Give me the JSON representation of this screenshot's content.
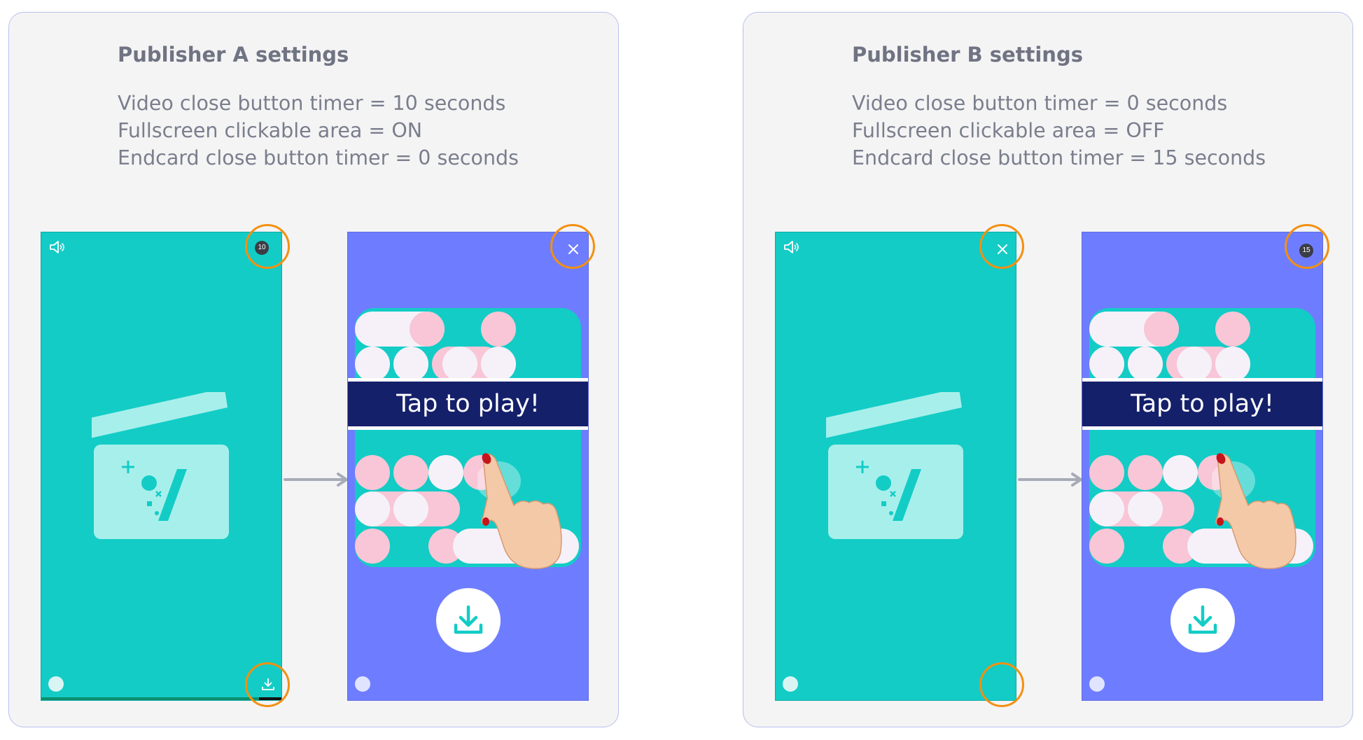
{
  "publisher_a": {
    "title": "Publisher A settings",
    "settings": [
      "Video close button timer = 10 seconds",
      "Fullscreen clickable area = ON",
      "Endcard close button timer = 0 seconds"
    ],
    "video_timer_badge": "10",
    "endcard_cta": "Tap to play!"
  },
  "publisher_b": {
    "title": "Publisher B settings",
    "settings": [
      "Video close button timer = 0 seconds",
      "Fullscreen clickable area = OFF",
      "Endcard close button timer = 15 seconds"
    ],
    "endcard_timer_badge": "15",
    "endcard_cta": "Tap to play!"
  },
  "icons": {
    "mute_toggle": "speaker-icon",
    "close": "close-icon",
    "download": "download-icon",
    "watermark": "brand-logo-icon",
    "video_placeholder": "clapperboard-icon",
    "hand": "tapping-hand-icon",
    "flow": "arrow-right-icon"
  },
  "colors": {
    "card_background": "#f4f4f5",
    "card_border": "#b9c0ee",
    "video_teal": "#13ccc6",
    "endcard_purple": "#6e7dff",
    "cta_band": "#15206a",
    "highlight_ring": "#f39010",
    "text_title": "#6f7382",
    "text_body": "#7a7e8c"
  }
}
